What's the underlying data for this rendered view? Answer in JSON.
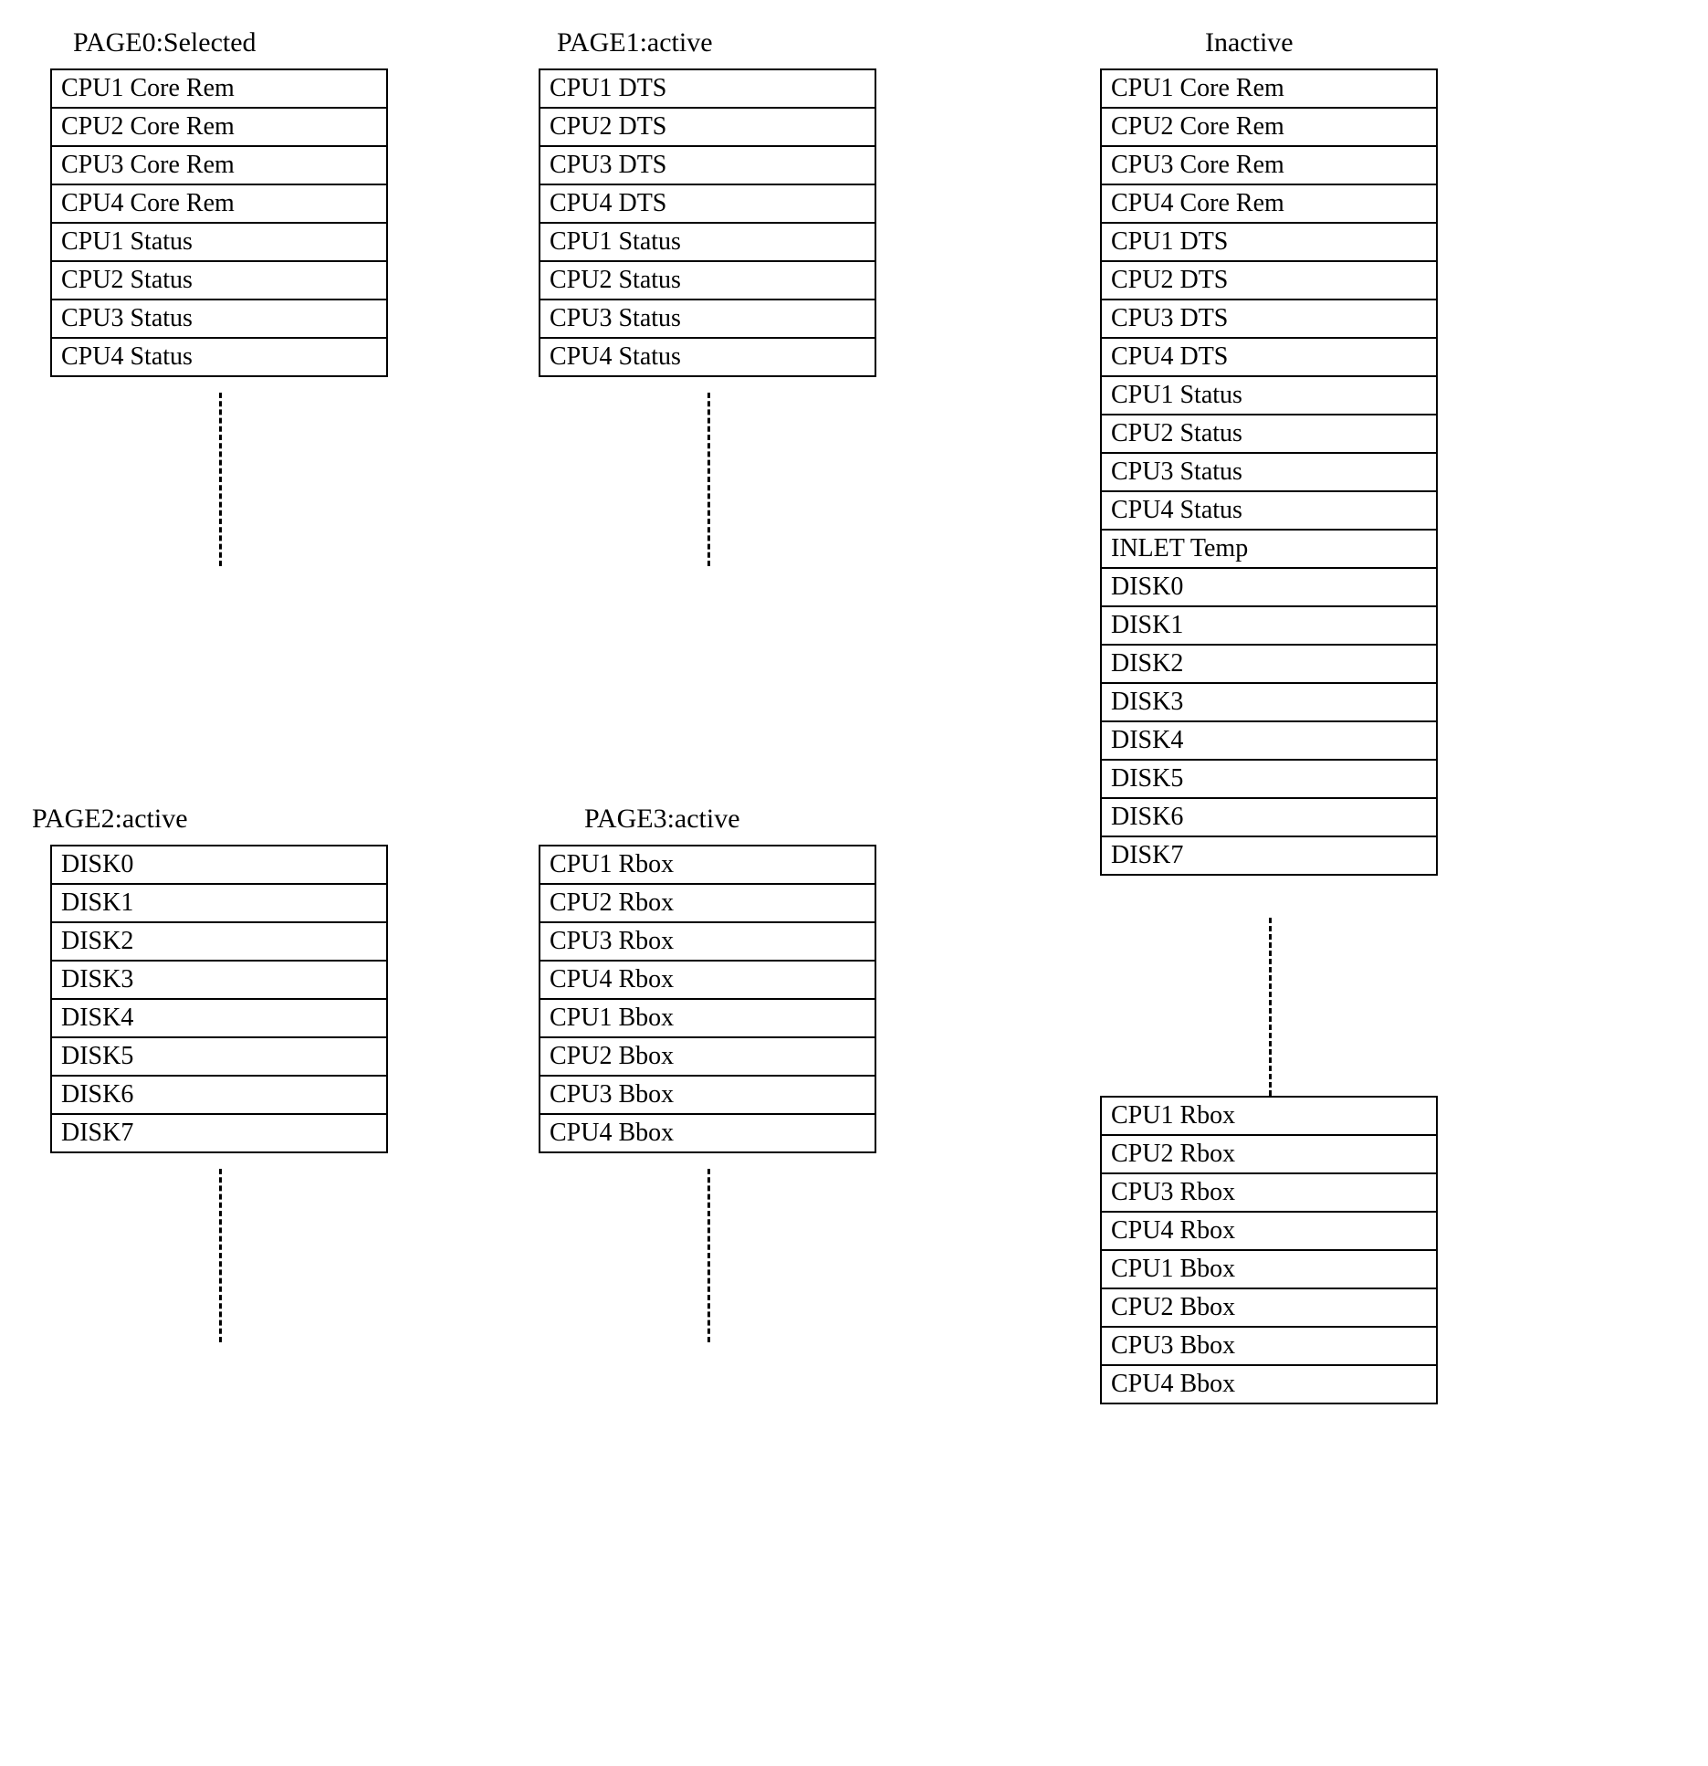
{
  "titles": {
    "page0": "PAGE0:Selected",
    "page1": "PAGE1:active",
    "page2": "PAGE2:active",
    "page3": "PAGE3:active",
    "inactive": "Inactive"
  },
  "page0": {
    "rows": [
      "CPU1 Core Rem",
      "CPU2 Core Rem",
      "CPU3 Core Rem",
      "CPU4 Core Rem",
      "CPU1 Status",
      "CPU2 Status",
      "CPU3 Status",
      "CPU4 Status"
    ]
  },
  "page1": {
    "rows": [
      "CPU1 DTS",
      "CPU2 DTS",
      "CPU3 DTS",
      "CPU4 DTS",
      "CPU1 Status",
      "CPU2 Status",
      "CPU3 Status",
      "CPU4 Status"
    ]
  },
  "page2": {
    "rows": [
      "DISK0",
      "DISK1",
      "DISK2",
      "DISK3",
      "DISK4",
      "DISK5",
      "DISK6",
      "DISK7"
    ]
  },
  "page3": {
    "rows": [
      "CPU1 Rbox",
      "CPU2 Rbox",
      "CPU3 Rbox",
      "CPU4 Rbox",
      "CPU1 Bbox",
      "CPU2 Bbox",
      "CPU3 Bbox",
      "CPU4 Bbox"
    ]
  },
  "inactive_top": {
    "rows": [
      "CPU1 Core Rem",
      "CPU2 Core Rem",
      "CPU3 Core Rem",
      "CPU4 Core Rem",
      "CPU1 DTS",
      "CPU2 DTS",
      "CPU3 DTS",
      "CPU4 DTS",
      "CPU1 Status",
      "CPU2 Status",
      "CPU3 Status",
      "CPU4 Status",
      "INLET Temp",
      "DISK0",
      "DISK1",
      "DISK2",
      "DISK3",
      "DISK4",
      "DISK5",
      "DISK6",
      "DISK7"
    ]
  },
  "inactive_bottom": {
    "rows": [
      "CPU1 Rbox",
      "CPU2 Rbox",
      "CPU3 Rbox",
      "CPU4 Rbox",
      "CPU1 Bbox",
      "CPU2 Bbox",
      "CPU3 Bbox",
      "CPU4 Bbox"
    ]
  }
}
